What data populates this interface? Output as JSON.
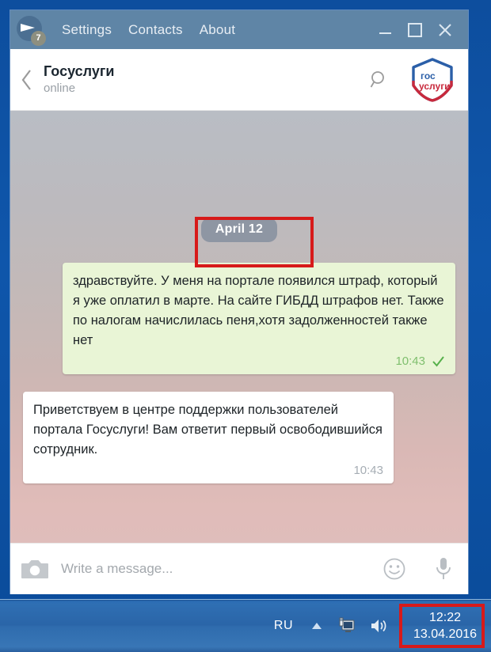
{
  "window": {
    "title_bar": {
      "app_logo_icon": "telegram-plane-icon",
      "unread_badge": "7",
      "menu": [
        {
          "label": "Settings"
        },
        {
          "label": "Contacts"
        },
        {
          "label": "About"
        }
      ],
      "controls": {
        "minimize_icon": "minimize-icon",
        "maximize_icon": "maximize-icon",
        "close_icon": "close-icon"
      }
    },
    "chat_header": {
      "back_icon": "back-chevron-icon",
      "peer_name": "Госуслуги",
      "peer_status": "online",
      "search_icon": "search-icon",
      "avatar_logo": {
        "icon": "gosuslugi-logo-icon",
        "line1": "гос",
        "line2": "услуги",
        "color_top": "#2b5fa8",
        "color_bottom": "#c8293c"
      }
    },
    "chat": {
      "date_divider": "April 12",
      "messages": [
        {
          "direction": "out",
          "text": "здравствуйте. У меня на портале появился штраф, который я уже оплатил в марте. На сайте ГИБДД штрафов нет. Также по налогам начислилась пеня,хотя задолженностей также нет",
          "time": "10:43",
          "status_icon": "single-check-icon"
        },
        {
          "direction": "in",
          "text": "Приветствуем в центре поддержки пользователей портала Госуслуги! Вам ответит первый освободившийся сотрудник.",
          "time": "10:43",
          "status_icon": ""
        }
      ]
    },
    "composer": {
      "camera_icon": "camera-icon",
      "input_value": "",
      "input_placeholder": "Write a message...",
      "emoji_icon": "smiley-icon",
      "mic_icon": "microphone-icon"
    }
  },
  "taskbar": {
    "language": "RU",
    "show_hidden_icons_icon": "chevron-up-icon",
    "network_icon": "network-monitor-icon",
    "volume_icon": "speaker-icon",
    "clock_time": "12:22",
    "clock_date": "13.04.2016"
  },
  "annotations": {
    "accent_color": "#d71a1a",
    "boxes": [
      {
        "target": "date-divider"
      },
      {
        "target": "taskbar-clock"
      }
    ]
  }
}
